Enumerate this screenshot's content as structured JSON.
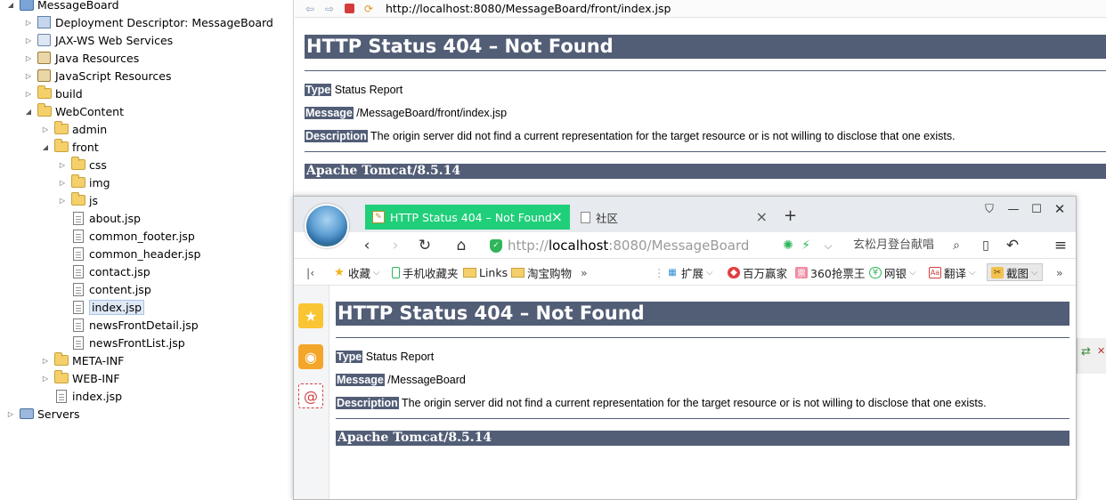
{
  "explorer": {
    "rows": [
      {
        "label": "MessageBoard",
        "icon": "project-icon"
      },
      {
        "label": "Deployment Descriptor: MessageBoard",
        "icon": "deployment-descriptor-icon"
      },
      {
        "label": "JAX-WS Web Services",
        "icon": "web-services-icon"
      },
      {
        "label": "Java Resources",
        "icon": "java-resources-icon"
      },
      {
        "label": "JavaScript Resources",
        "icon": "javascript-resources-icon"
      },
      {
        "label": "build",
        "icon": "folder-icon"
      },
      {
        "label": "WebContent",
        "icon": "folder-open-icon"
      },
      {
        "label": "admin",
        "icon": "folder-icon"
      },
      {
        "label": "front",
        "icon": "folder-open-icon"
      },
      {
        "label": "css",
        "icon": "folder-icon"
      },
      {
        "label": "img",
        "icon": "folder-icon"
      },
      {
        "label": "js",
        "icon": "folder-icon"
      },
      {
        "label": "about.jsp",
        "icon": "jsp-file-icon"
      },
      {
        "label": "common_footer.jsp",
        "icon": "jsp-file-icon"
      },
      {
        "label": "common_header.jsp",
        "icon": "jsp-file-icon"
      },
      {
        "label": "contact.jsp",
        "icon": "jsp-file-icon"
      },
      {
        "label": "content.jsp",
        "icon": "jsp-file-icon"
      },
      {
        "label": "index.jsp",
        "icon": "jsp-file-icon"
      },
      {
        "label": "newsFrontDetail.jsp",
        "icon": "jsp-file-icon"
      },
      {
        "label": "newsFrontList.jsp",
        "icon": "jsp-file-icon"
      },
      {
        "label": "META-INF",
        "icon": "folder-icon"
      },
      {
        "label": "WEB-INF",
        "icon": "folder-icon"
      },
      {
        "label": "index.jsp",
        "icon": "jsp-file-icon"
      },
      {
        "label": "Servers",
        "icon": "servers-icon"
      }
    ]
  },
  "eclipse_browser": {
    "url": "http://localhost:8080/MessageBoard/front/index.jsp",
    "page": {
      "title": "HTTP Status 404 – Not Found",
      "type_key": "Type",
      "type_value": "Status Report",
      "message_key": "Message",
      "message_value": "/MessageBoard/front/index.jsp",
      "description_key": "Description",
      "description_value": "The origin server did not find a current representation for the target resource or is not willing to disclose that one exists.",
      "footer": "Apache Tomcat/8.5.14"
    }
  },
  "browser360": {
    "tabs": [
      {
        "label": "HTTP Status 404 – Not Found",
        "active": true
      },
      {
        "label": "社区",
        "active": false
      }
    ],
    "url_scheme": "http://",
    "url_host": "localhost",
    "url_rest": ":8080/MessageBoard",
    "search_text": "玄松月登台献唱",
    "bookmarks": {
      "favorites": "收藏",
      "mobile_favorites": "手机收藏夹",
      "links": "Links",
      "taobao": "淘宝购物",
      "extensions": "扩展",
      "baiwan": "百万赢家",
      "qiangpiao": "360抢票王",
      "bank": "网银",
      "translate": "翻译",
      "screenshot": "截图"
    },
    "page": {
      "title": "HTTP Status 404 – Not Found",
      "type_key": "Type",
      "type_value": "Status Report",
      "message_key": "Message",
      "message_value": "/MessageBoard",
      "description_key": "Description",
      "description_value": "The origin server did not find a current representation for the target resource or is not willing to disclose that one exists.",
      "footer": "Apache Tomcat/8.5.14"
    }
  },
  "colors": {
    "tomcat_header": "#525d76",
    "active_tab": "#20cf7a",
    "secure_shield": "#2fb55a"
  }
}
